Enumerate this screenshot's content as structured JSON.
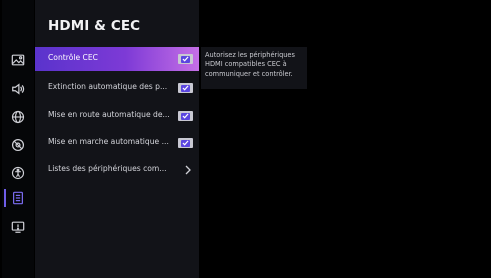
{
  "settings": {
    "title": "HDMI & CEC",
    "items": [
      {
        "label": "Contrôle CEC",
        "control": "checkbox",
        "checked": true,
        "active": true
      },
      {
        "label": "Extinction automatique des p...",
        "control": "checkbox",
        "checked": true,
        "active": false
      },
      {
        "label": "Mise en route automatique de...",
        "control": "checkbox",
        "checked": true,
        "active": false
      },
      {
        "label": "Mise en marche automatique ...",
        "control": "checkbox",
        "checked": true,
        "active": false
      },
      {
        "label": "Listes des périphériques com...",
        "control": "chevron",
        "active": false
      }
    ]
  },
  "tooltip": {
    "text": "Autorisez les périphériques HDMI compatibles CEC à communiquer et contrôler."
  },
  "sidebar": {
    "icons": [
      "picture-icon",
      "sound-icon",
      "network-icon",
      "channels-icon",
      "accessibility-icon",
      "inputs-icon",
      "system-icon"
    ],
    "selected": "inputs-icon"
  },
  "colors": {
    "accent": "#6f5de8",
    "highlight_start": "#5a33cc",
    "highlight_end": "#c56fe6",
    "panel_bg": "#121318",
    "screen_bg": "#000000"
  }
}
